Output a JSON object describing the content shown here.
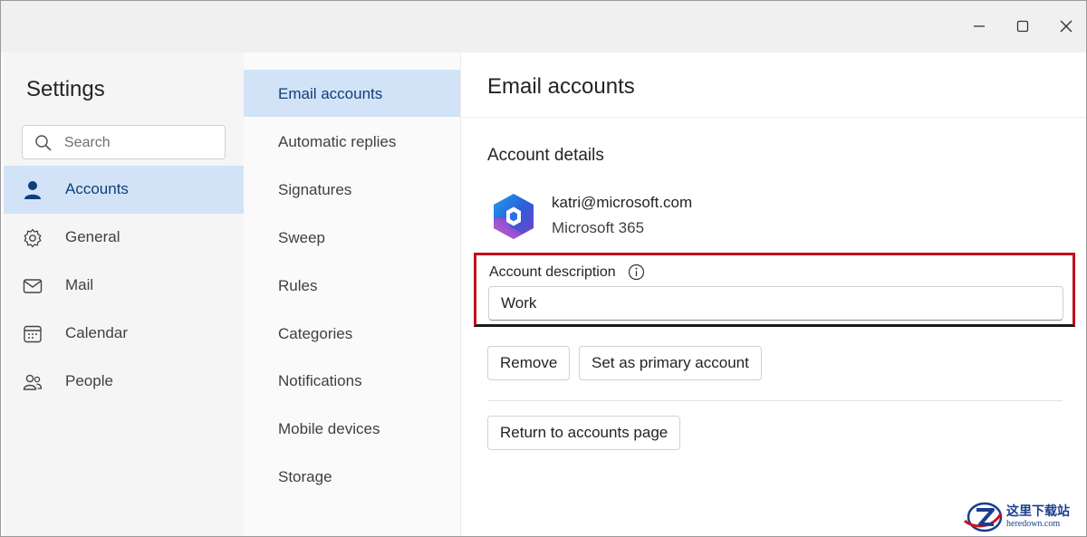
{
  "window": {
    "controls": {
      "minimize": "minimize-icon",
      "maximize": "maximize-icon",
      "close": "close-icon"
    }
  },
  "nav": {
    "title": "Settings",
    "search": {
      "placeholder": "Search",
      "value": ""
    },
    "items": [
      {
        "label": "Accounts",
        "icon": "person-icon",
        "selected": true
      },
      {
        "label": "General",
        "icon": "gear-icon",
        "selected": false
      },
      {
        "label": "Mail",
        "icon": "mail-icon",
        "selected": false
      },
      {
        "label": "Calendar",
        "icon": "calendar-icon",
        "selected": false
      },
      {
        "label": "People",
        "icon": "people-icon",
        "selected": false
      }
    ]
  },
  "subnav": {
    "items": [
      {
        "label": "Email accounts",
        "selected": true
      },
      {
        "label": "Automatic replies",
        "selected": false
      },
      {
        "label": "Signatures",
        "selected": false
      },
      {
        "label": "Sweep",
        "selected": false
      },
      {
        "label": "Rules",
        "selected": false
      },
      {
        "label": "Categories",
        "selected": false
      },
      {
        "label": "Notifications",
        "selected": false
      },
      {
        "label": "Mobile devices",
        "selected": false
      },
      {
        "label": "Storage",
        "selected": false
      }
    ]
  },
  "content": {
    "title": "Email accounts",
    "section_title": "Account details",
    "account": {
      "email": "katri@microsoft.com",
      "type": "Microsoft 365",
      "logo": "microsoft-365-logo"
    },
    "description": {
      "label": "Account description",
      "value": "Work",
      "info_icon": "info-icon"
    },
    "buttons": {
      "remove": "Remove",
      "set_primary": "Set as primary account",
      "return": "Return to accounts page"
    }
  },
  "watermark": {
    "text_cn": "这里下载站",
    "text_en": "heredown.com"
  },
  "colors": {
    "selected_bg": "#d3e3f7",
    "highlight_border": "#c0101d",
    "accent": "#0f6cbd"
  }
}
